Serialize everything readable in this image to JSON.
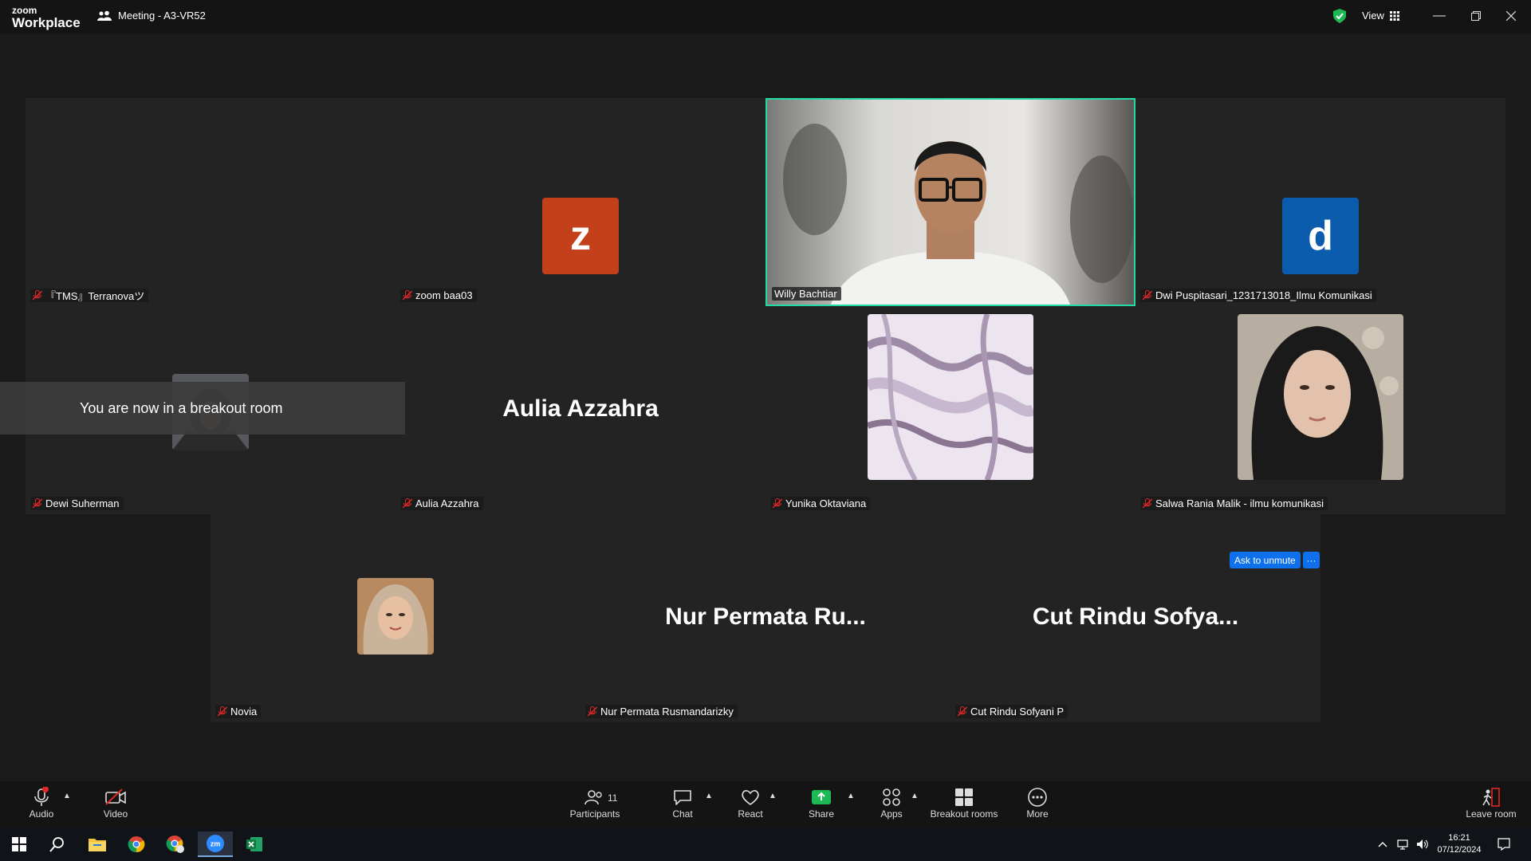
{
  "titlebar": {
    "logo_line1": "zoom",
    "logo_line2": "Workplace",
    "meeting_title": "Meeting - A3-VR52",
    "view_label": "View"
  },
  "row1": [
    {
      "name": "『TMS』Terranovaツ",
      "type": "blank"
    },
    {
      "name": "zoom baa03",
      "type": "letter",
      "letter": "z",
      "color": "#c4401a"
    },
    {
      "name": "Willy Bachtiar",
      "type": "video"
    },
    {
      "name": "Dwi Puspitasari_1231713018_Ilmu Komunikasi",
      "type": "letter",
      "letter": "d",
      "color": "#0b5cad"
    }
  ],
  "row2": [
    {
      "name": "Dewi Suherman",
      "type": "photo"
    },
    {
      "name": "Aulia Azzahra",
      "type": "text",
      "display": "Aulia Azzahra"
    },
    {
      "name": "Yunika Oktaviana",
      "type": "photo"
    },
    {
      "name": "Salwa Rania Malik - ilmu komunikasi",
      "type": "photo"
    }
  ],
  "row3": [
    {
      "name": "Novia",
      "type": "photo"
    },
    {
      "name": "Nur Permata Rusmandarizky",
      "type": "text",
      "display": "Nur Permata Ru..."
    },
    {
      "name": "Cut Rindu Sofyani P",
      "type": "text",
      "display": "Cut Rindu Sofya..."
    }
  ],
  "toast": "You are now in a breakout room",
  "ask_unmute": "Ask to unmute",
  "ask_more": "···",
  "toolbar": {
    "audio": "Audio",
    "video": "Video",
    "participants": "Participants",
    "participants_count": "11",
    "chat": "Chat",
    "react": "React",
    "share": "Share",
    "apps": "Apps",
    "breakout_rooms": "Breakout rooms",
    "more": "More",
    "leave_room": "Leave room"
  },
  "taskbar": {
    "time": "16:21",
    "date": "07/12/2024"
  },
  "colors": {
    "active_speaker": "#23d9a4",
    "share_green": "#1db954",
    "ask_unmute_blue": "#0e71eb",
    "mic_off_red": "#e02828"
  }
}
